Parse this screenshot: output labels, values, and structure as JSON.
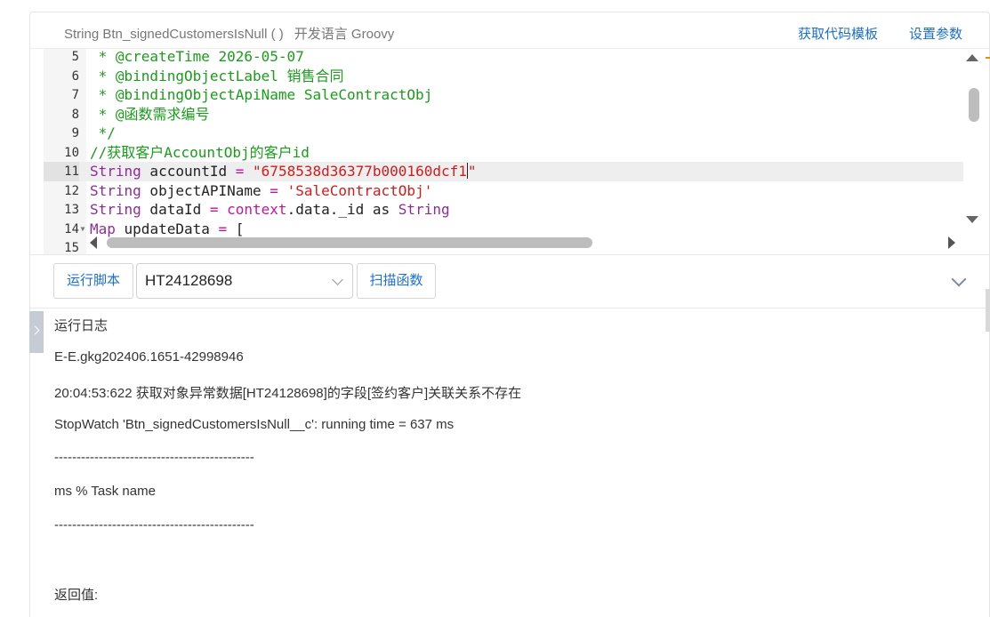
{
  "header": {
    "function_signature": "String Btn_signedCustomersIsNull ( )",
    "language": "开发语言 Groovy",
    "get_template_link": "获取代码模板",
    "settings_link": "设置参数"
  },
  "editor": {
    "active_line": "11",
    "lines": [
      {
        "num": "5",
        "segments": [
          {
            "t": " * @createTime 2026-05-07",
            "c": "green"
          }
        ]
      },
      {
        "num": "6",
        "segments": [
          {
            "t": " * @bindingObjectLabel 销售合同",
            "c": "green"
          }
        ]
      },
      {
        "num": "7",
        "segments": [
          {
            "t": " * @bindingObjectApiName SaleContractObj",
            "c": "green"
          }
        ]
      },
      {
        "num": "8",
        "segments": [
          {
            "t": " * @函数需求编号",
            "c": "green"
          }
        ]
      },
      {
        "num": "9",
        "segments": [
          {
            "t": " */",
            "c": "green"
          }
        ]
      },
      {
        "num": "10",
        "segments": [
          {
            "t": "//获取客户AccountObj的客户id",
            "c": "green"
          }
        ]
      },
      {
        "num": "11",
        "segments": [
          {
            "t": "String",
            "c": "purple"
          },
          {
            "t": " accountId ",
            "c": "black"
          },
          {
            "t": "=",
            "c": "pink"
          },
          {
            "t": " \"6758538d36377b000160dcf1",
            "c": "red"
          },
          {
            "t": "\"",
            "c": "red"
          }
        ]
      },
      {
        "num": "12",
        "segments": [
          {
            "t": "String",
            "c": "purple"
          },
          {
            "t": " objectAPIName ",
            "c": "black"
          },
          {
            "t": "=",
            "c": "pink"
          },
          {
            "t": " 'SaleContractObj'",
            "c": "red"
          }
        ]
      },
      {
        "num": "13",
        "segments": [
          {
            "t": "String",
            "c": "purple"
          },
          {
            "t": " dataId ",
            "c": "black"
          },
          {
            "t": "=",
            "c": "pink"
          },
          {
            "t": " context",
            "c": "pink"
          },
          {
            "t": ".data._id as ",
            "c": "black"
          },
          {
            "t": "String",
            "c": "purple"
          }
        ]
      },
      {
        "num": "14",
        "fold": true,
        "segments": [
          {
            "t": "Map",
            "c": "purple"
          },
          {
            "t": " updateData ",
            "c": "black"
          },
          {
            "t": "=",
            "c": "pink"
          },
          {
            "t": " [",
            "c": "black"
          }
        ]
      },
      {
        "num": "15",
        "segments": []
      }
    ]
  },
  "toolbar": {
    "run_label": "运行脚本",
    "record_value": "HT24128698",
    "scan_label": "扫描函数"
  },
  "log": {
    "title": "运行日志",
    "lines": [
      "E-E.gkg202406.1651-42998946",
      "20:04:53:622 获取对象异常数据[HT24128698]的字段[签约客户]关联关系不存在",
      "StopWatch 'Btn_signedCustomersIsNull__c': running time = 637 ms",
      "---------------------------------------------",
      "ms % Task name",
      "---------------------------------------------"
    ],
    "return_label": "返回值:"
  },
  "colors": {
    "link": "#1b6fd0",
    "comment": "#1a9c1a",
    "keyword": "#8e2b9a",
    "string": "#d01c1c",
    "operator": "#c0169e"
  }
}
